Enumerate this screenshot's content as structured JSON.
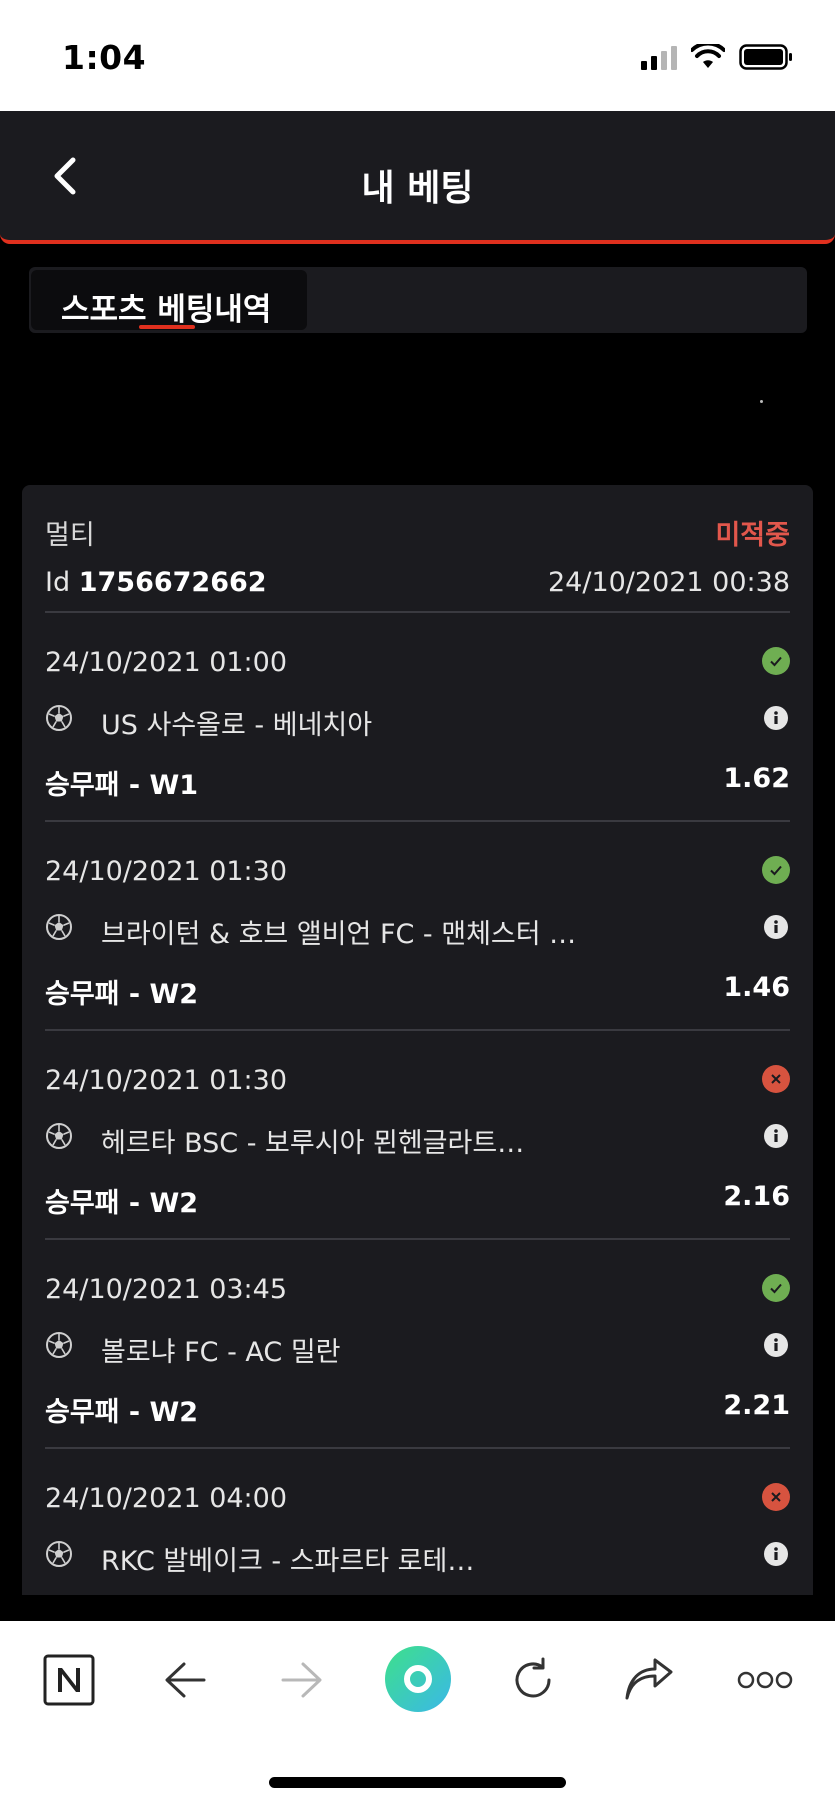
{
  "status_bar": {
    "time": "1:04"
  },
  "header": {
    "title": "내 베팅"
  },
  "tabs": [
    {
      "label": "스포츠 베팅내역",
      "active": true
    }
  ],
  "bet": {
    "type": "멀티",
    "status": "미적중",
    "id_label": "Id",
    "id_value": "1756672662",
    "placed_at": "24/10/2021 00:38",
    "selections": [
      {
        "date": "24/10/2021 01:00",
        "match": "US 사수올로 - 베네치아",
        "market": "승무패 - W1",
        "odds": "1.62",
        "result": "win"
      },
      {
        "date": "24/10/2021 01:30",
        "match": "브라이턴 & 호브 앨비언 FC - 맨체스터 …",
        "market": "승무패 - W2",
        "odds": "1.46",
        "result": "win"
      },
      {
        "date": "24/10/2021 01:30",
        "match": "헤르타 BSC - 보루시아 묀헨글라트…",
        "market": "승무패 - W2",
        "odds": "2.16",
        "result": "lose"
      },
      {
        "date": "24/10/2021 03:45",
        "match": "볼로냐 FC - AC 밀란",
        "market": "승무패 - W2",
        "odds": "2.21",
        "result": "win"
      },
      {
        "date": "24/10/2021 04:00",
        "match": "RKC 발베이크 - 스파르타 로테…",
        "market": "",
        "odds": "",
        "result": "lose"
      }
    ]
  },
  "colors": {
    "accent": "#e0301e",
    "win": "#6fae52",
    "lose": "#d7533f",
    "card": "#1b1b1f"
  },
  "icons": {
    "back": "chevron-left-icon",
    "sport": "soccer-ball-icon",
    "info": "info-icon",
    "win": "check-circle-icon",
    "lose": "x-circle-icon"
  }
}
